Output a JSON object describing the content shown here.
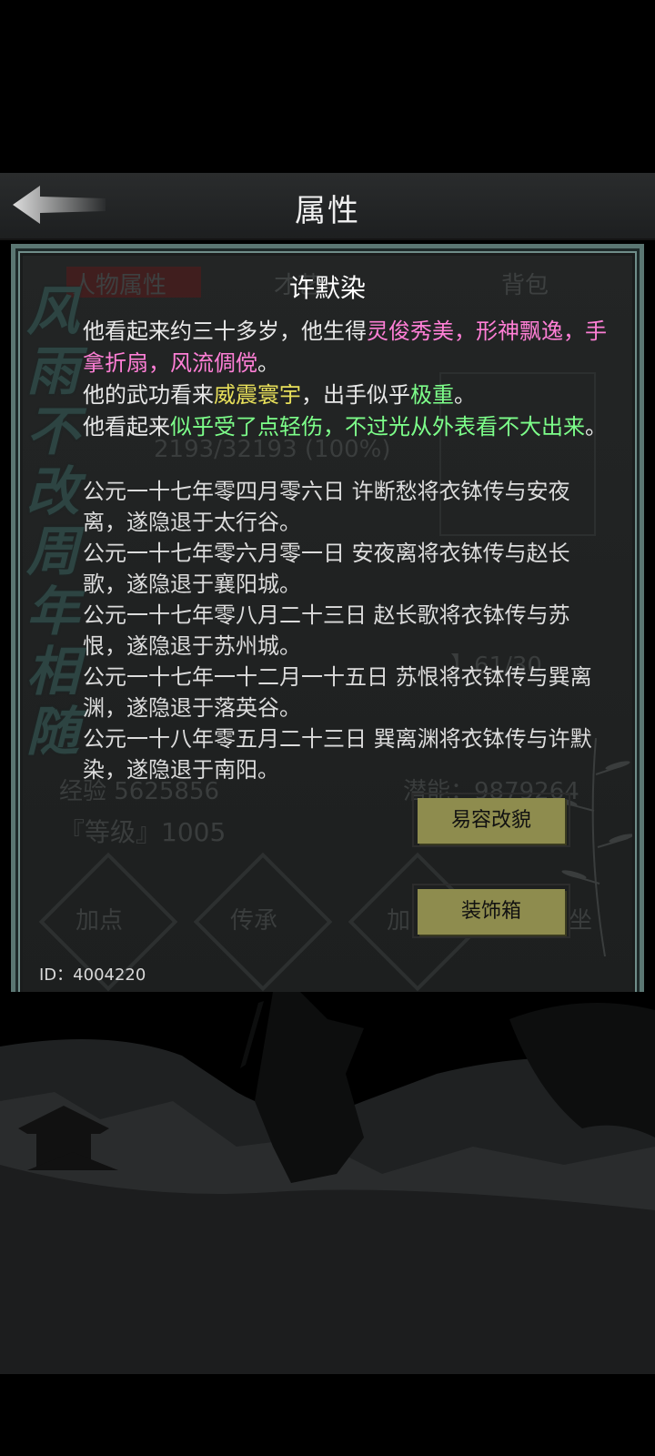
{
  "header": {
    "title": "属性",
    "back_label": "返回"
  },
  "panel": {
    "ghost": {
      "tab_active": "人物属性",
      "tab_mid": "才艺",
      "tab_right": "背包",
      "hp_line": "2193/32193 (100%)",
      "exp_line": "经验 5625856",
      "level_line": "『等级』1005",
      "potential": "潜能：9879264",
      "stat_line": "】61/30",
      "btn_add": "加点",
      "btn_inherit": "传承",
      "btn_add2": "加",
      "btn_sit": "坐"
    },
    "calligraphy": "风雨不改 周年相随",
    "character_name": "许默染",
    "description": {
      "line1_prefix": "他看起来约三十多岁，他生得",
      "line1_highlight": "灵俊秀美，形神飘逸，手拿折扇，风流倜傥",
      "line1_suffix": "。",
      "line2_prefix": "他的武功看来",
      "line2_highlight1": "威震寰宇",
      "line2_mid": "，出手似乎",
      "line2_highlight2": "极重",
      "line2_suffix": "。",
      "line3_prefix": "他看起来",
      "line3_highlight": "似乎受了点轻伤，不过光从外表看不大出来",
      "line3_suffix": "。"
    },
    "history": [
      "公元一十七年零四月零六日 许断愁将衣钵传与安夜离，遂隐退于太行谷。",
      "公元一十七年零六月零一日 安夜离将衣钵传与赵长歌，遂隐退于襄阳城。",
      "公元一十七年零八月二十三日 赵长歌将衣钵传与苏恨，遂隐退于苏州城。",
      "公元一十七年一十二月一十五日 苏恨将衣钵传与巽离渊，遂隐退于落英谷。",
      "公元一十八年零五月二十三日 巽离渊将衣钵传与许默染，遂隐退于南阳。"
    ],
    "buttons": {
      "disguise": "易容改貌",
      "decoration_box": "装饰箱"
    },
    "user_id": "ID：4004220"
  },
  "colors": {
    "pink": "#ff7fd6",
    "yellow": "#e8e05a",
    "green": "#7dff8a",
    "button": "#8e8c4e",
    "frame": "#5a7672"
  }
}
